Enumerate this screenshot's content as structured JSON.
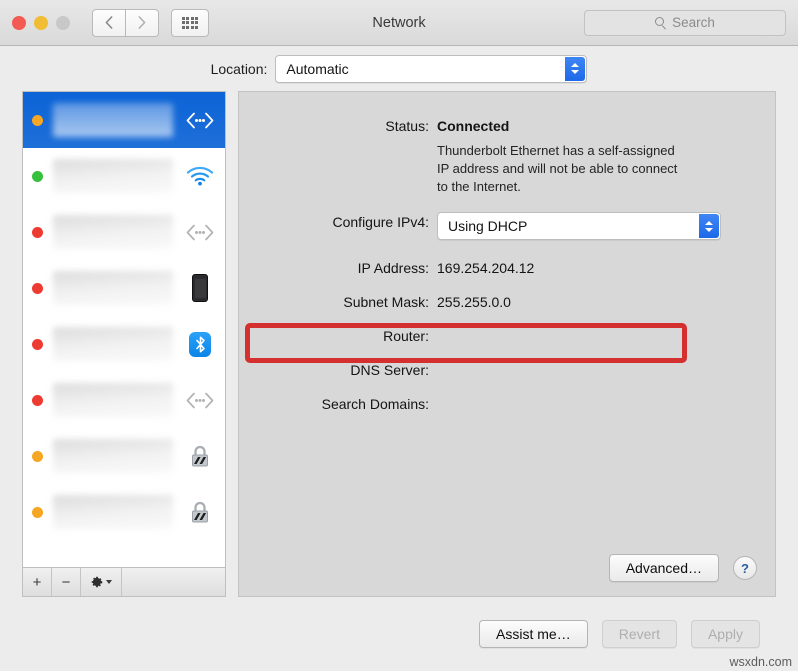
{
  "window": {
    "title": "Network",
    "traffic_lights": [
      "close",
      "minimize",
      "zoom"
    ],
    "search_placeholder": "Search"
  },
  "location": {
    "label": "Location:",
    "value": "Automatic"
  },
  "sidebar": {
    "services": [
      {
        "status": "orange",
        "icon": "ethernet-icon",
        "selected": true
      },
      {
        "status": "green",
        "icon": "wifi-icon",
        "selected": false
      },
      {
        "status": "red",
        "icon": "ethernet-icon",
        "selected": false
      },
      {
        "status": "red",
        "icon": "iphone-icon",
        "selected": false
      },
      {
        "status": "red",
        "icon": "bluetooth-icon",
        "selected": false
      },
      {
        "status": "red",
        "icon": "ethernet-icon",
        "selected": false
      },
      {
        "status": "orange",
        "icon": "lock-icon",
        "selected": false
      },
      {
        "status": "orange",
        "icon": "lock-icon",
        "selected": false
      }
    ],
    "toolbar": {
      "add_label": "+",
      "remove_label": "−",
      "action_icon": "gear-icon"
    }
  },
  "detail": {
    "status_label": "Status:",
    "status_value": "Connected",
    "status_note": "Thunderbolt Ethernet has a self-assigned IP address and will not be able to connect to the Internet.",
    "configure_label": "Configure IPv4:",
    "configure_value": "Using DHCP",
    "fields": [
      {
        "label": "IP Address:",
        "value": "169.254.204.12"
      },
      {
        "label": "Subnet Mask:",
        "value": "255.255.0.0"
      },
      {
        "label": "Router:",
        "value": ""
      },
      {
        "label": "DNS Server:",
        "value": ""
      },
      {
        "label": "Search Domains:",
        "value": ""
      }
    ],
    "advanced_label": "Advanced…",
    "help_label": "?",
    "highlight_color": "#d3302f"
  },
  "footer": {
    "assist_label": "Assist me…",
    "revert_label": "Revert",
    "apply_label": "Apply",
    "watermark": "wsxdn.com"
  }
}
